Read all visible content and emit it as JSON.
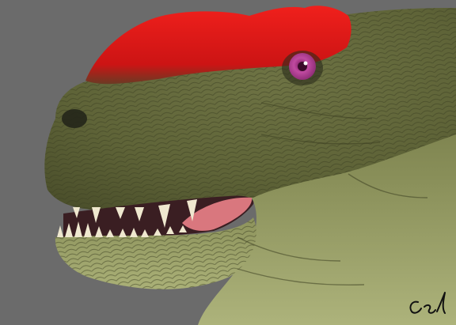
{
  "image": {
    "subject": "dinosaur-head",
    "background_color": "#6b6b6b",
    "skin_color": "#5f6438",
    "belly_color": "#a7ad73",
    "crest_color": "#e01414",
    "eye_color": "#b0338f",
    "tongue_color": "#d9777e",
    "tooth_color": "#efe8cf",
    "signature": "cel"
  }
}
